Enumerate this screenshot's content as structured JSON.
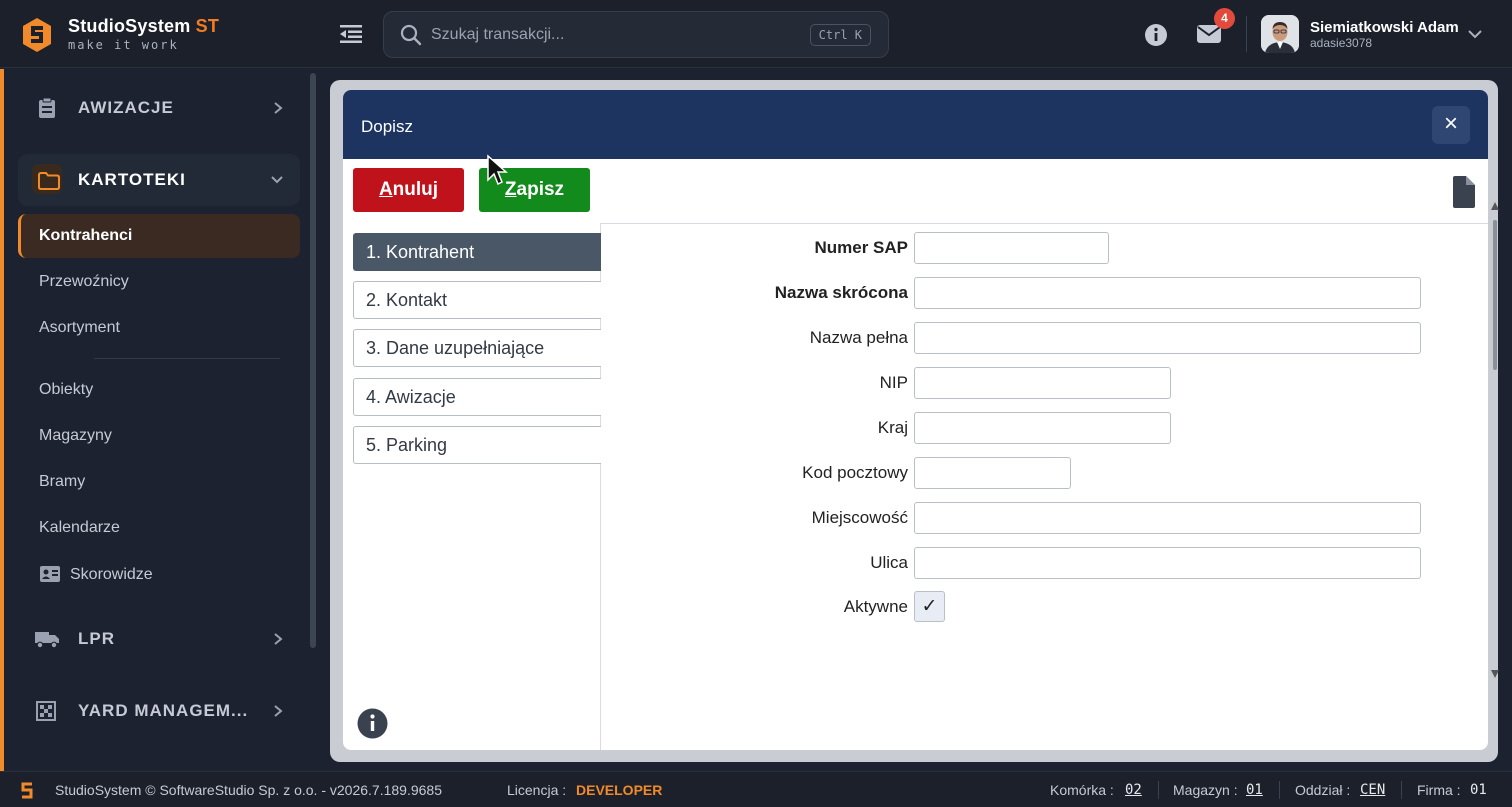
{
  "brand": {
    "name": "StudioSystem",
    "suffix": "ST",
    "tagline": "make it work"
  },
  "search": {
    "placeholder": "Szukaj transakcji...",
    "shortcut": "Ctrl K"
  },
  "header": {
    "mail_count": "4",
    "user_name": "Siemiatkowski Adam",
    "user_login": "adasie3078"
  },
  "sidebar": {
    "sections": [
      {
        "label": "AWIZACJE",
        "icon": "clipboard-icon"
      },
      {
        "label": "KARTOTEKI",
        "icon": "folder-icon"
      },
      {
        "label": "LPR",
        "icon": "truck-icon"
      },
      {
        "label": "YARD MANAGEM...",
        "icon": "grid-icon"
      }
    ],
    "items": [
      {
        "label": "Kontrahenci"
      },
      {
        "label": "Przewoźnicy"
      },
      {
        "label": "Asortyment"
      },
      {
        "label": "Obiekty"
      },
      {
        "label": "Magazyny"
      },
      {
        "label": "Bramy"
      },
      {
        "label": "Kalendarze"
      },
      {
        "label": "Skorowidze"
      }
    ]
  },
  "modal": {
    "title": "Dopisz",
    "close": "×",
    "cancel_rest": "nuluj",
    "cancel_key": "A",
    "save_rest": "apisz",
    "save_key": "Z",
    "steps": [
      "1. Kontrahent",
      "2. Kontakt",
      "3. Dane uzupełniające",
      "4. Awizacje",
      "5. Parking"
    ],
    "fields": [
      {
        "label": "Numer SAP",
        "value": ""
      },
      {
        "label": "Nazwa skrócona",
        "value": ""
      },
      {
        "label": "Nazwa pełna",
        "value": ""
      },
      {
        "label": "NIP",
        "value": ""
      },
      {
        "label": "Kraj",
        "value": ""
      },
      {
        "label": "Kod pocztowy",
        "value": ""
      },
      {
        "label": "Miejscowość",
        "value": ""
      },
      {
        "label": "Ulica",
        "value": ""
      }
    ],
    "active_label": "Aktywne",
    "active_mark": "✓"
  },
  "footer": {
    "copyright": "StudioSystem © SoftwareStudio Sp. z o.o. - v2026.7.189.9685",
    "license_label": "Licencja :",
    "license_value": "DEVELOPER",
    "komorka_label": "Komórka :",
    "komorka_value": "02",
    "magazyn_label": "Magazyn :",
    "magazyn_value": "01",
    "oddzial_label": "Oddział :",
    "oddzial_value": "CEN",
    "firma_label": "Firma :",
    "firma_value": "01"
  },
  "colors": {
    "accent": "#f08a2a",
    "modal_header": "#1d3461",
    "cancel": "#c0121b",
    "save": "#128a1c",
    "step_active": "#4a5767"
  }
}
